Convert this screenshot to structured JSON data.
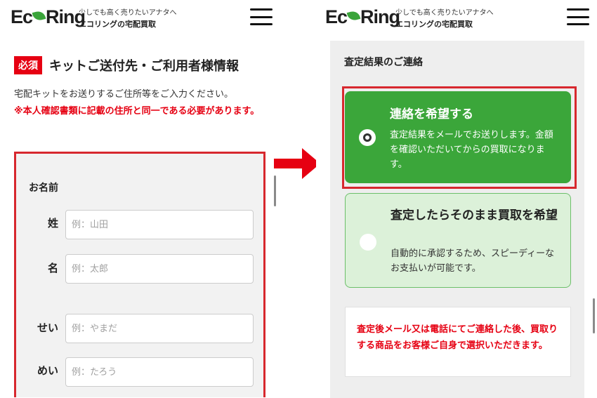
{
  "brand": {
    "logo_before": "Ec",
    "logo_leaf": "o",
    "logo_after": "Ring",
    "tagline_line1": "少しでも高く売りたいアナタへ",
    "tagline_line2": "エコリングの宅配買取",
    "leaf_color": "#3aa43a"
  },
  "left": {
    "required_badge": "必須",
    "section_title": "キットご送付先・ご利用者様情報",
    "intro": "宅配キットをお送りするご住所等をご入力ください。",
    "notice": "※本人確認書類に記載の住所と同一である必要があります。",
    "form": {
      "name_label": "お名前",
      "last_name_label": "姓",
      "last_name_placeholder": "例：山田",
      "first_name_label": "名",
      "first_name_placeholder": "例：太郎",
      "last_kana_label": "せい",
      "last_kana_placeholder": "例：やまだ",
      "first_kana_label": "めい",
      "first_kana_placeholder": "例：たろう"
    }
  },
  "right": {
    "result_title": "査定結果のご連絡",
    "option_contact": {
      "title": "連絡を希望する",
      "description": "査定結果をメールでお送りします。金額を確認いただいてからの買取になります。",
      "selected": true
    },
    "option_direct": {
      "title": "査定したらそのまま買取を希望",
      "description": "自動的に承認するため、スピーディーなお支払いが可能です。",
      "selected": false
    },
    "note": "査定後メール又は電話にてご連絡した後、買取りする商品をお客様ご自身で選択いただきます。"
  },
  "colors": {
    "accent_red": "#e60012",
    "highlight_red": "#d7282e",
    "selected_green": "#3ba63a",
    "unselected_green": "#dcf1d9"
  },
  "icons": {
    "menu": "hamburger-menu-icon",
    "arrow": "right-arrow-icon"
  }
}
